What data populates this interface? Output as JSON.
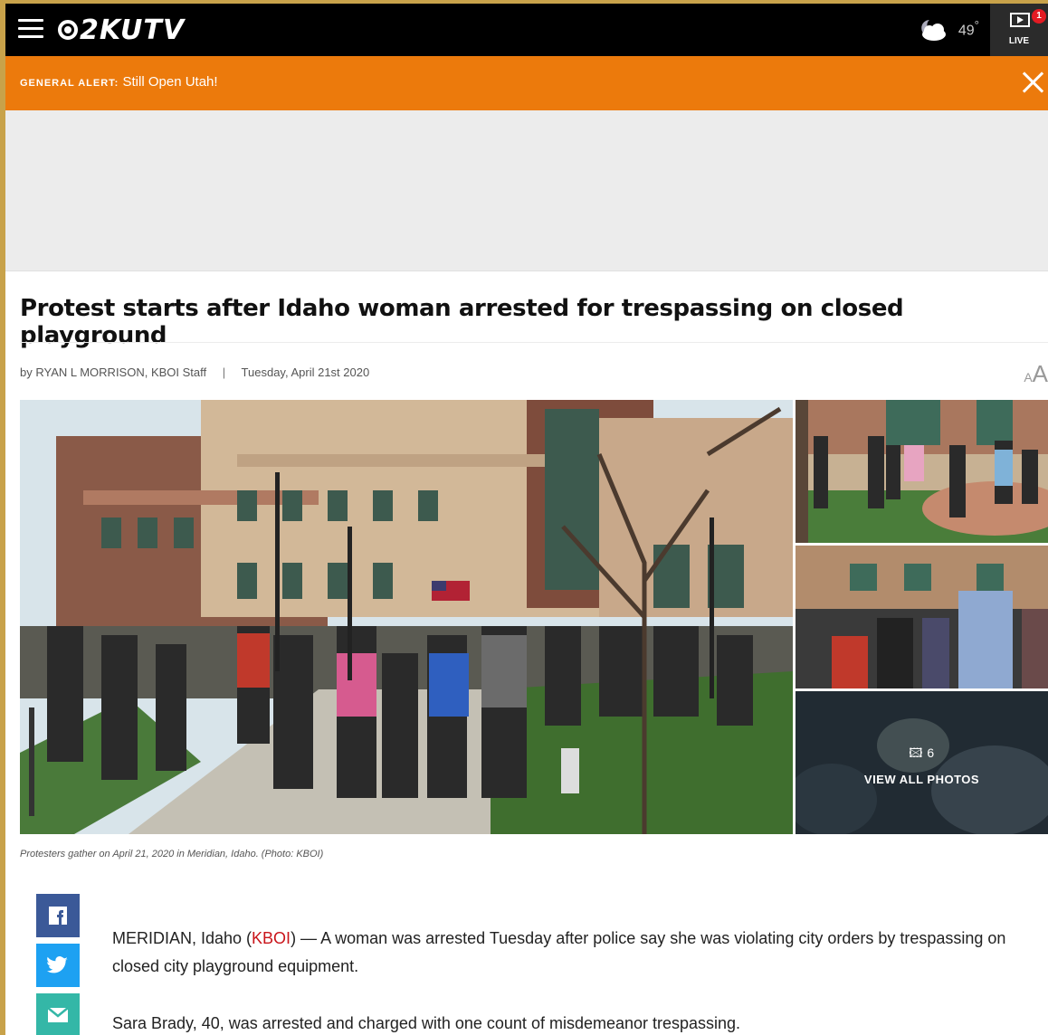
{
  "header": {
    "brand": "KUTV",
    "channel": "2",
    "temperature": "49",
    "degree": "°",
    "live_label": "LIVE",
    "live_badge": "1"
  },
  "alert": {
    "tag": "GENERAL ALERT:",
    "message": " Still Open Utah!"
  },
  "article": {
    "headline": "Protest starts after Idaho woman arrested for trespassing on closed playground",
    "byline": "by RYAN L MORRISON, KBOI Staff",
    "separator": "|",
    "date": "Tuesday, April 21st 2020",
    "text_size_small": "A",
    "text_size_large": "A",
    "caption": "Protesters gather on April 21, 2020 in Meridian, Idaho. (Photo: KBOI)",
    "gallery": {
      "photo_count": "6",
      "view_all_label": "VIEW ALL PHOTOS"
    },
    "paragraph1_prefix": "MERIDIAN, Idaho (",
    "paragraph1_link": "KBOI",
    "paragraph1_suffix": ") — A woman was arrested Tuesday after police say she was violating city orders by trespassing on closed city playground equipment.",
    "paragraph2": "Sara Brady, 40, was arrested and charged with one count of misdemeanor trespassing."
  },
  "colors": {
    "alert_bg": "#ec7a0c",
    "link": "#c9141a",
    "facebook": "#3b5998",
    "twitter": "#1da1f2",
    "email": "#34b7a7"
  }
}
